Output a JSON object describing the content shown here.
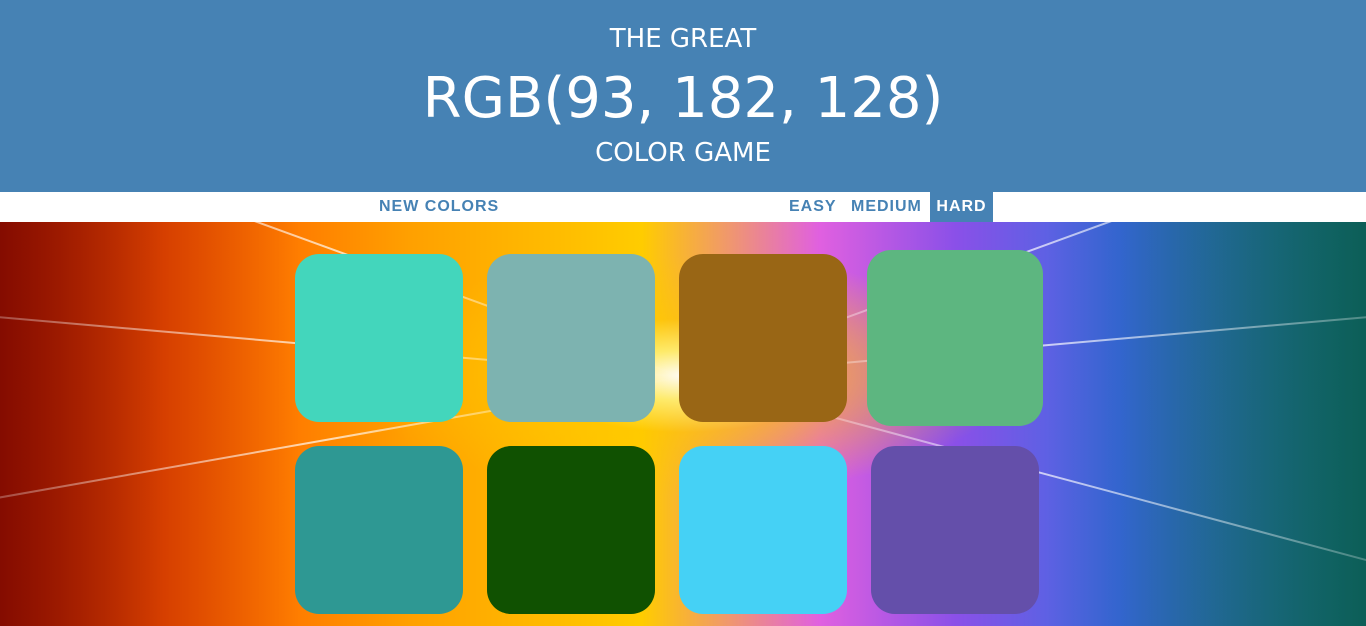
{
  "header": {
    "title_top": "THE GREAT",
    "rgb_display": "RGB(93, 182, 128)",
    "title_bottom": "COLOR GAME",
    "background_color": "#4682b4"
  },
  "controls": {
    "new_colors_label": "NEW COLORS",
    "modes": [
      {
        "label": "EASY",
        "selected": false
      },
      {
        "label": "MEDIUM",
        "selected": false
      },
      {
        "label": "HARD",
        "selected": true
      }
    ],
    "accent_color": "#4682b4"
  },
  "squares": [
    {
      "color": "#43d6bc"
    },
    {
      "color": "#7db3b0"
    },
    {
      "color": "#996615"
    },
    {
      "color": "#5db680"
    },
    {
      "color": "#2e9893"
    },
    {
      "color": "#105101"
    },
    {
      "color": "#45d1f5"
    },
    {
      "color": "#644faa"
    }
  ],
  "background": {
    "description_icon": "speed-burst-image"
  }
}
